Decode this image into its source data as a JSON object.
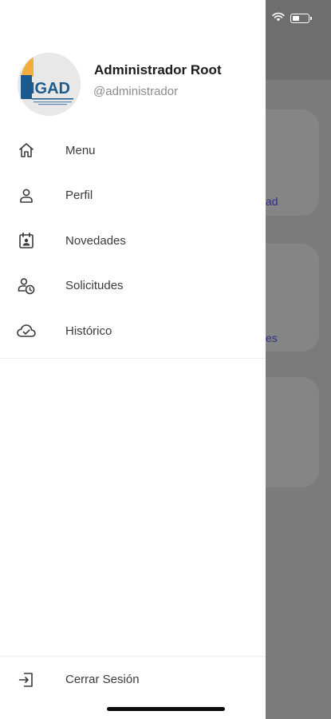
{
  "background": {
    "card_link_1": "ad",
    "card_link_2": "es"
  },
  "status_bar": {
    "wifi_icon": "wifi-icon",
    "battery_icon": "battery-icon"
  },
  "profile": {
    "logo_text": "IGAD",
    "name": "Administrador Root",
    "handle": "@administrador"
  },
  "menu": {
    "items": [
      {
        "label": "Menu",
        "icon": "home-icon"
      },
      {
        "label": "Perfil",
        "icon": "user-icon"
      },
      {
        "label": "Novedades",
        "icon": "calendar-user-icon"
      },
      {
        "label": "Solicitudes",
        "icon": "user-clock-icon"
      },
      {
        "label": "Histórico",
        "icon": "cloud-check-icon"
      }
    ]
  },
  "footer": {
    "logout_label": "Cerrar Sesión",
    "logout_icon": "logout-icon"
  },
  "colors": {
    "overlay": "#7b7b7b",
    "drawer": "#ffffff",
    "link": "#2f2f8a",
    "logo_blue": "#1f5a8c",
    "logo_orange": "#f2ad3c"
  }
}
